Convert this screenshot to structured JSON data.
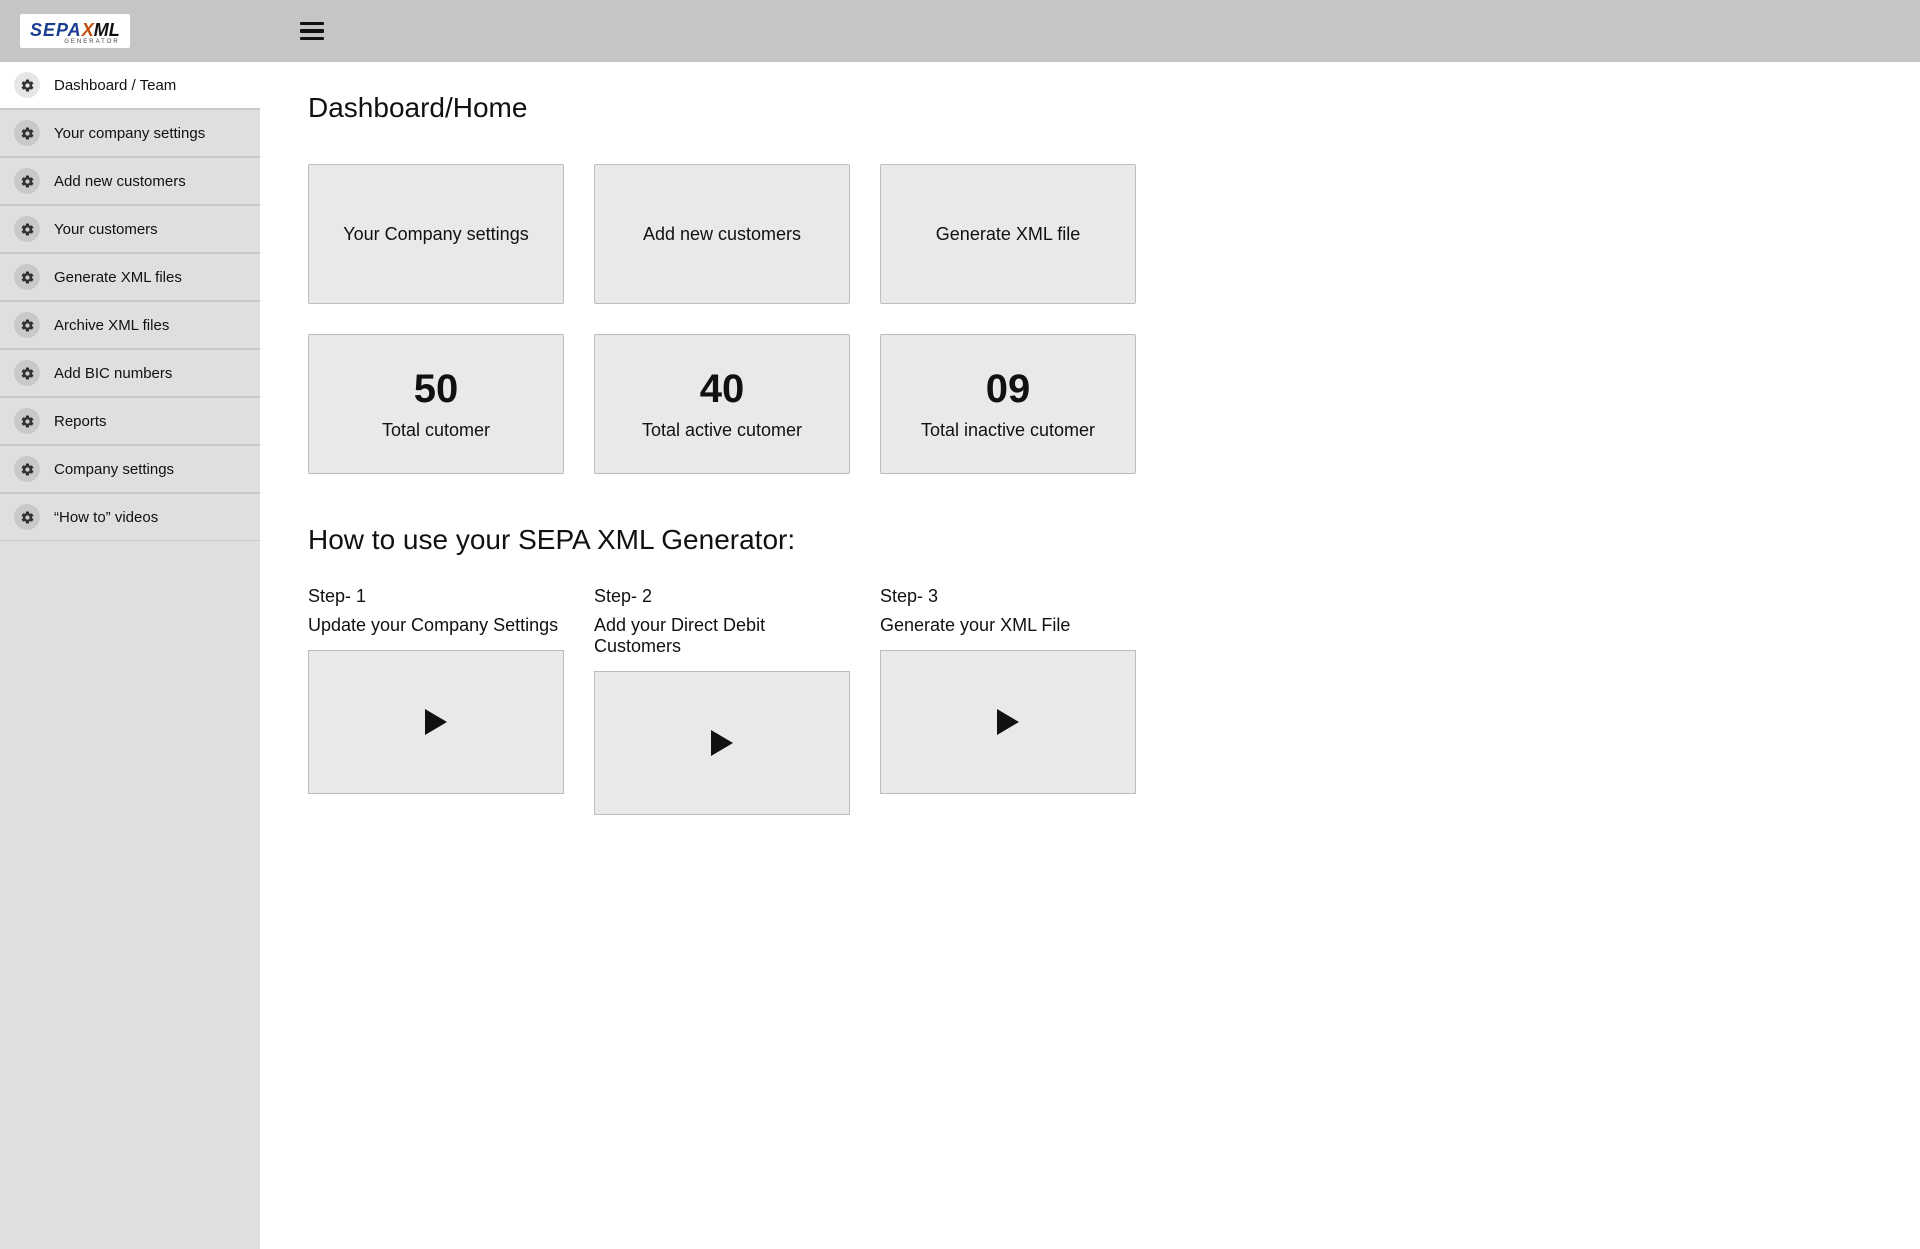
{
  "logo": {
    "sepa": "SEPA",
    "x": "X",
    "ml": "ML",
    "sub": "GENERATOR"
  },
  "sidebar": {
    "items": [
      {
        "label": "Dashboard / Team",
        "active": true
      },
      {
        "label": "Your company settings",
        "active": false
      },
      {
        "label": "Add new customers",
        "active": false
      },
      {
        "label": "Your customers",
        "active": false
      },
      {
        "label": "Generate XML files",
        "active": false
      },
      {
        "label": "Archive XML files",
        "active": false
      },
      {
        "label": "Add BIC numbers",
        "active": false
      },
      {
        "label": "Reports",
        "active": false
      },
      {
        "label": "Company settings",
        "active": false
      },
      {
        "label": "“How to” videos",
        "active": false
      }
    ]
  },
  "page": {
    "title": "Dashboard/Home"
  },
  "quicklinks": [
    {
      "label": "Your Company settings"
    },
    {
      "label": "Add new customers"
    },
    {
      "label": "Generate XML file"
    }
  ],
  "stats": [
    {
      "value": "50",
      "label": "Total cutomer"
    },
    {
      "value": "40",
      "label": "Total active cutomer"
    },
    {
      "value": "09",
      "label": "Total inactive cutomer"
    }
  ],
  "howto": {
    "title": "How to use your SEPA XML Generator:",
    "steps": [
      {
        "step": "Step- 1",
        "desc": "Update your Company Settings"
      },
      {
        "step": "Step- 2",
        "desc": "Add your Direct Debit Customers"
      },
      {
        "step": "Step- 3",
        "desc": "Generate your XML File"
      }
    ]
  }
}
